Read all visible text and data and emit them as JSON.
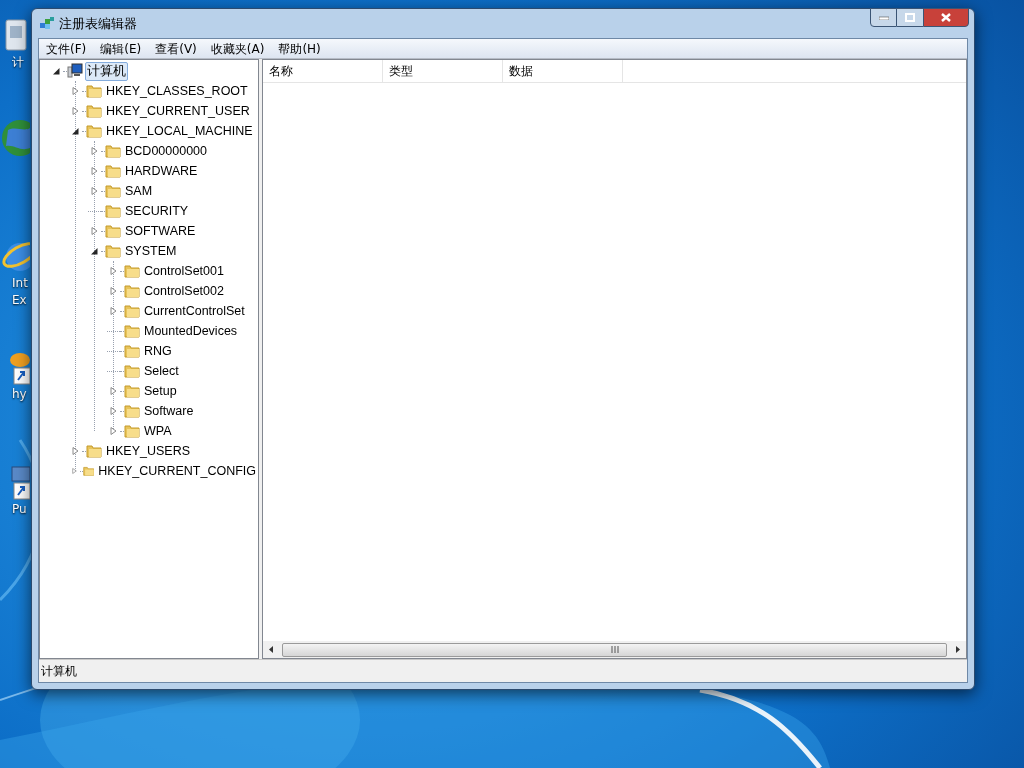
{
  "desktop_icons": [
    {
      "kind": "computer",
      "label": [
        "计"
      ]
    },
    {
      "kind": "globe"
    },
    {
      "kind": "browser",
      "label": [
        "Int",
        "Ex"
      ]
    },
    {
      "kind": "shortcut",
      "label": [
        "hy"
      ]
    },
    {
      "kind": "terminal",
      "label": [
        "Pu"
      ]
    }
  ],
  "window": {
    "title": "注册表编辑器"
  },
  "menu": [
    "文件(F)",
    "编辑(E)",
    "查看(V)",
    "收藏夹(A)",
    "帮助(H)"
  ],
  "tree": [
    {
      "label": "计算机",
      "kind": "computer",
      "expanded": true,
      "selected": true,
      "children": [
        {
          "label": "HKEY_CLASSES_ROOT",
          "kind": "folder",
          "expanded": false,
          "selected": false
        },
        {
          "label": "HKEY_CURRENT_USER",
          "kind": "folder",
          "expanded": false,
          "selected": false
        },
        {
          "label": "HKEY_LOCAL_MACHINE",
          "kind": "folder",
          "expanded": true,
          "selected": false,
          "children": [
            {
              "label": "BCD00000000",
              "kind": "folder",
              "expanded": false,
              "selected": false
            },
            {
              "label": "HARDWARE",
              "kind": "folder",
              "expanded": false,
              "selected": false
            },
            {
              "label": "SAM",
              "kind": "folder",
              "expanded": false,
              "selected": false
            },
            {
              "label": "SECURITY",
              "kind": "folder",
              "selected": false
            },
            {
              "label": "SOFTWARE",
              "kind": "folder",
              "expanded": false,
              "selected": false
            },
            {
              "label": "SYSTEM",
              "kind": "folder",
              "expanded": true,
              "selected": false,
              "children": [
                {
                  "label": "ControlSet001",
                  "kind": "folder",
                  "expanded": false,
                  "selected": false
                },
                {
                  "label": "ControlSet002",
                  "kind": "folder",
                  "expanded": false,
                  "selected": false
                },
                {
                  "label": "CurrentControlSet",
                  "kind": "folder",
                  "expanded": false,
                  "selected": false
                },
                {
                  "label": "MountedDevices",
                  "kind": "folder",
                  "selected": false
                },
                {
                  "label": "RNG",
                  "kind": "folder",
                  "selected": false
                },
                {
                  "label": "Select",
                  "kind": "folder",
                  "selected": false
                },
                {
                  "label": "Setup",
                  "kind": "folder",
                  "expanded": false,
                  "selected": false
                },
                {
                  "label": "Software",
                  "kind": "folder",
                  "expanded": false,
                  "selected": false
                },
                {
                  "label": "WPA",
                  "kind": "folder",
                  "expanded": false,
                  "selected": false
                }
              ]
            }
          ]
        },
        {
          "label": "HKEY_USERS",
          "kind": "folder",
          "expanded": false,
          "selected": false
        },
        {
          "label": "HKEY_CURRENT_CONFIG",
          "kind": "folder",
          "expanded": false,
          "selected": false
        }
      ]
    }
  ],
  "list": {
    "columns": [
      "名称",
      "类型",
      "数据"
    ]
  },
  "status_bar": {
    "text": "计算机"
  }
}
